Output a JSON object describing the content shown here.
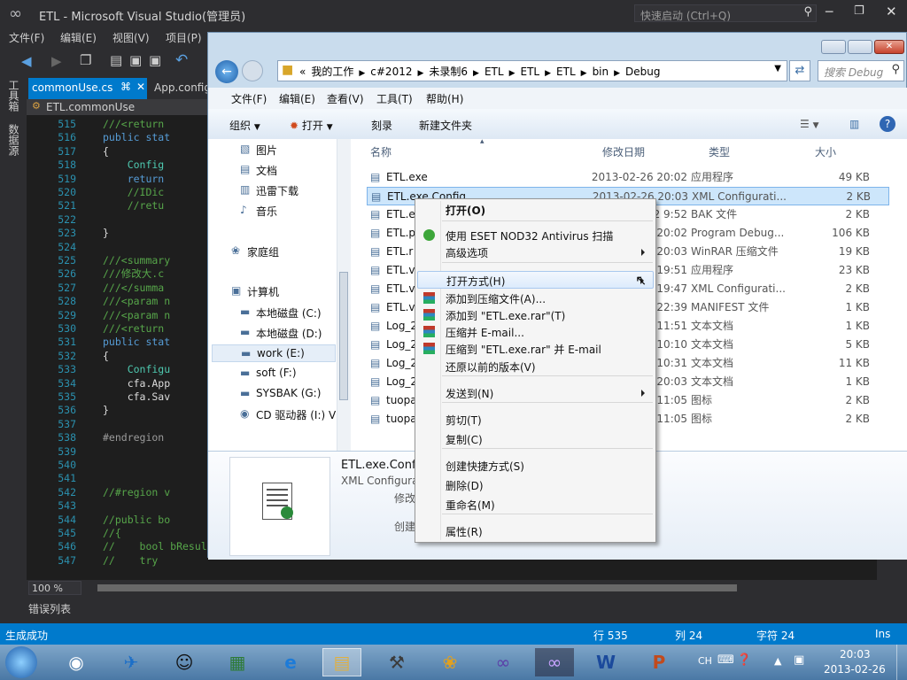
{
  "vs": {
    "title": "ETL - Microsoft Visual Studio(管理员)",
    "quick_launch_placeholder": "快速启动 (Ctrl+Q)",
    "menu": [
      "文件(F)",
      "编辑(E)",
      "视图(V)",
      "项目(P)"
    ],
    "side_tabs": [
      "工具箱",
      "数据源"
    ],
    "tabs": [
      {
        "label": "commonUse.cs",
        "active": true
      },
      {
        "label": "App.config",
        "active": false
      }
    ],
    "nav_combo": "ETL.commonUse",
    "code_lines": [
      {
        "num": "515",
        "text": "///<return"
      },
      {
        "num": "516",
        "text": "public stat"
      },
      {
        "num": "517",
        "text": "{"
      },
      {
        "num": "518",
        "text": "    Config"
      },
      {
        "num": "519",
        "text": "    return"
      },
      {
        "num": "520",
        "text": "    //IDic"
      },
      {
        "num": "521",
        "text": "    //retu"
      },
      {
        "num": "522",
        "text": ""
      },
      {
        "num": "523",
        "text": "}"
      },
      {
        "num": "524",
        "text": ""
      },
      {
        "num": "525",
        "text": "///<summary"
      },
      {
        "num": "526",
        "text": "///修改大.c"
      },
      {
        "num": "527",
        "text": "///</summa"
      },
      {
        "num": "528",
        "text": "///<param n"
      },
      {
        "num": "529",
        "text": "///<param n"
      },
      {
        "num": "530",
        "text": "///<return"
      },
      {
        "num": "531",
        "text": "public stat"
      },
      {
        "num": "532",
        "text": "{"
      },
      {
        "num": "533",
        "text": "    Configu"
      },
      {
        "num": "534",
        "text": "    cfa.App"
      },
      {
        "num": "535",
        "text": "    cfa.Sav"
      },
      {
        "num": "536",
        "text": "}"
      },
      {
        "num": "537",
        "text": ""
      },
      {
        "num": "538",
        "text": "#endregion"
      },
      {
        "num": "539",
        "text": ""
      },
      {
        "num": "540",
        "text": ""
      },
      {
        "num": "541",
        "text": ""
      },
      {
        "num": "542",
        "text": "//#region v"
      },
      {
        "num": "543",
        "text": ""
      },
      {
        "num": "544",
        "text": "//public bo"
      },
      {
        "num": "545",
        "text": "//{"
      },
      {
        "num": "546",
        "text": "//    bool bResult = false;"
      },
      {
        "num": "547",
        "text": "//    try"
      }
    ],
    "zoom": "100 %",
    "error_list": "错误列表",
    "status": {
      "message": "生成成功",
      "line": "行 535",
      "col": "列 24",
      "char": "字符 24",
      "mode": "Ins"
    }
  },
  "explorer": {
    "breadcrumb": [
      "«",
      "我的工作",
      "c#2012",
      "未录制6",
      "ETL",
      "ETL",
      "ETL",
      "bin",
      "Debug"
    ],
    "search_placeholder": "搜索 Debug",
    "menu": [
      "文件(F)",
      "编辑(E)",
      "查看(V)",
      "工具(T)",
      "帮助(H)"
    ],
    "commands": [
      "组织",
      "打开",
      "刻录",
      "新建文件夹"
    ],
    "nav_items": [
      {
        "label": "图片",
        "icon": "pictures-icon"
      },
      {
        "label": "文档",
        "icon": "documents-icon"
      },
      {
        "label": "迅雷下载",
        "icon": "downloads-icon"
      },
      {
        "label": "音乐",
        "icon": "music-icon"
      },
      {
        "label": "家庭组",
        "icon": "homegroup-icon"
      },
      {
        "label": "计算机",
        "icon": "computer-icon"
      },
      {
        "label": "本地磁盘 (C:)",
        "icon": "drive-icon"
      },
      {
        "label": "本地磁盘 (D:)",
        "icon": "drive-icon"
      },
      {
        "label": "work (E:)",
        "icon": "drive-icon"
      },
      {
        "label": "soft (F:)",
        "icon": "drive-icon"
      },
      {
        "label": "SYSBAK (G:)",
        "icon": "drive-icon"
      },
      {
        "label": "CD 驱动器 (I:) V",
        "icon": "cd-drive-icon"
      }
    ],
    "columns": [
      "名称",
      "修改日期",
      "类型",
      "大小"
    ],
    "files": [
      {
        "name": "ETL.exe",
        "date": "2013-02-26 20:02",
        "type": "应用程序",
        "size": "49 KB"
      },
      {
        "name": "ETL.exe.Config",
        "date": "2013-02-26 20:03",
        "type": "XML Configurati...",
        "size": "2 KB"
      },
      {
        "name": "ETL.e",
        "date": "2 9:52",
        "type": "BAK 文件",
        "size": "2 KB"
      },
      {
        "name": "ETL.p",
        "date": "5 20:02",
        "type": "Program Debug...",
        "size": "106 KB"
      },
      {
        "name": "ETL.r",
        "date": "5 20:03",
        "type": "WinRAR 压缩文件",
        "size": "19 KB"
      },
      {
        "name": "ETL.v",
        "date": "5 19:51",
        "type": "应用程序",
        "size": "23 KB"
      },
      {
        "name": "ETL.v",
        "date": "5 19:47",
        "type": "XML Configurati...",
        "size": "2 KB"
      },
      {
        "name": "ETL.v",
        "date": "7 22:39",
        "type": "MANIFEST 文件",
        "size": "1 KB"
      },
      {
        "name": "Log_2",
        "date": "5 11:51",
        "type": "文本文档",
        "size": "1 KB"
      },
      {
        "name": "Log_2",
        "date": "2 10:10",
        "type": "文本文档",
        "size": "5 KB"
      },
      {
        "name": "Log_2",
        "date": "0 10:31",
        "type": "文本文档",
        "size": "11 KB"
      },
      {
        "name": "Log_2",
        "date": "5 20:03",
        "type": "文本文档",
        "size": "1 KB"
      },
      {
        "name": "tuopa",
        "date": "5 11:05",
        "type": "图标",
        "size": "2 KB"
      },
      {
        "name": "tuopa",
        "date": "5 11:05",
        "type": "图标",
        "size": "2 KB"
      }
    ],
    "details": {
      "name": "ETL.exe.Config",
      "type": "XML Configura",
      "modified_label": "修改",
      "created_label": "创建"
    }
  },
  "context_menu": {
    "items": [
      {
        "label": "打开(O)",
        "bold": true
      },
      {
        "label": "使用 ESET NOD32 Antivirus 扫描",
        "icon": "eset-icon"
      },
      {
        "label": "高级选项",
        "submenu": true
      },
      {
        "label": "打开方式(H)",
        "submenu": true,
        "hover": true
      },
      {
        "label": "添加到压缩文件(A)...",
        "icon": "winrar-icon"
      },
      {
        "label": "添加到 \"ETL.exe.rar\"(T)",
        "icon": "winrar-icon"
      },
      {
        "label": "压缩并 E-mail...",
        "icon": "winrar-icon"
      },
      {
        "label": "压缩到 \"ETL.exe.rar\" 并 E-mail",
        "icon": "winrar-icon"
      },
      {
        "label": "还原以前的版本(V)"
      },
      {
        "label": "发送到(N)",
        "submenu": true
      },
      {
        "label": "剪切(T)"
      },
      {
        "label": "复制(C)"
      },
      {
        "label": "创建快捷方式(S)"
      },
      {
        "label": "删除(D)"
      },
      {
        "label": "重命名(M)"
      },
      {
        "label": "属性(R)"
      }
    ]
  },
  "taskbar": {
    "lang": "CH",
    "time": "20:03",
    "date": "2013-02-26"
  },
  "colors": {
    "vs_status": "#007acc",
    "vs_bg": "#2d2d30",
    "editor_bg": "#1e1e1e",
    "selection": "#cde6fb"
  }
}
